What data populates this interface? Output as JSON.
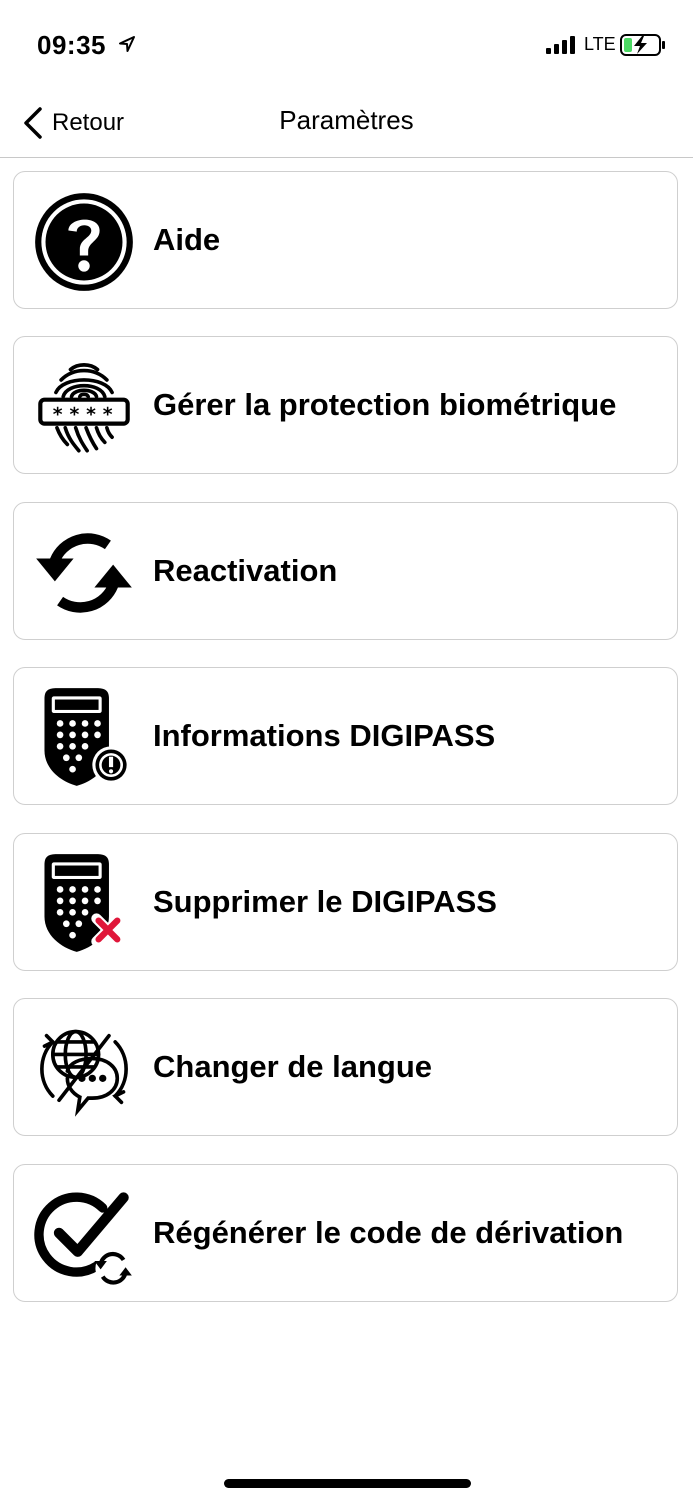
{
  "status_bar": {
    "time": "09:35",
    "network": "LTE",
    "location_icon": "location-arrow-icon",
    "signal_icon": "signal-bars-icon",
    "battery_icon": "battery-charging-icon",
    "battery_color": "#4cd964"
  },
  "nav": {
    "back_label": "Retour",
    "title": "Paramètres"
  },
  "menu": [
    {
      "label": "Aide",
      "icon": "help-circle-icon"
    },
    {
      "label": "Gérer la protection biométrique",
      "icon": "fingerprint-pin-icon"
    },
    {
      "label": "Reactivation",
      "icon": "refresh-icon"
    },
    {
      "label": "Informations DIGIPASS",
      "icon": "digipass-info-icon"
    },
    {
      "label": "Supprimer le DIGIPASS",
      "icon": "digipass-delete-icon"
    },
    {
      "label": "Changer de langue",
      "icon": "language-globe-icon"
    },
    {
      "label": "Régénérer le code de dérivation",
      "icon": "check-refresh-icon"
    }
  ],
  "colors": {
    "delete_accent": "#e0173a",
    "card_border": "#cfcfcf",
    "divider": "#c8c8c8"
  }
}
